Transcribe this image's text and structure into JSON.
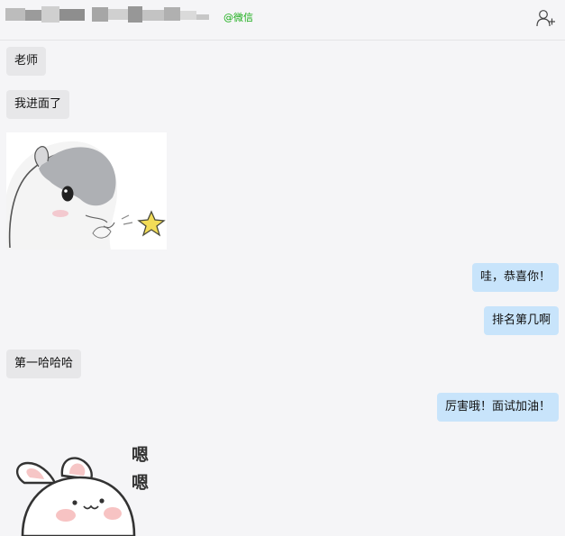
{
  "header": {
    "source_tag": "@微信",
    "add_user_icon": "add-contact-icon"
  },
  "messages": [
    {
      "side": "left",
      "text": "老师"
    },
    {
      "side": "left",
      "text": "我进面了"
    },
    {
      "side": "left",
      "sticker": "hamster-sticker"
    },
    {
      "side": "right",
      "text": "哇，恭喜你！"
    },
    {
      "side": "right",
      "text": "排名第几啊"
    },
    {
      "side": "left",
      "text": "第一哈哈哈"
    },
    {
      "side": "right",
      "text": "厉害哦！面试加油！"
    },
    {
      "side": "left",
      "sticker": "bunny-sticker",
      "sticker_text": "嗯嗯"
    }
  ],
  "colors": {
    "left_bubble": "#e7e7e9",
    "right_bubble": "#c8e4fb",
    "wechat_green": "#1aad19"
  }
}
